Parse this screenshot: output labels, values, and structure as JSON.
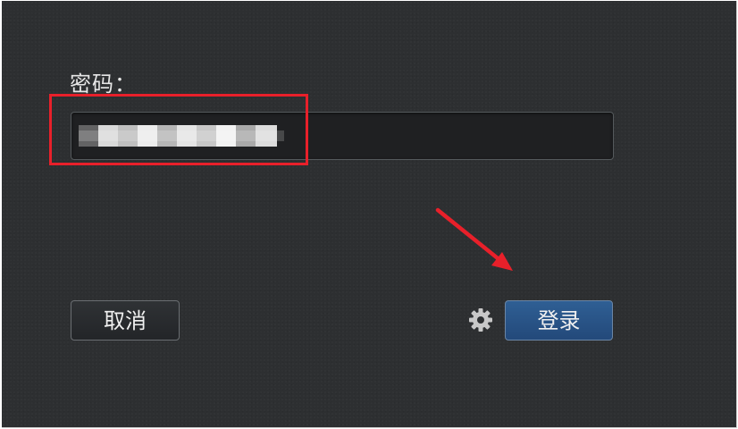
{
  "login": {
    "password_label": "密码：",
    "cancel_label": "取消",
    "login_label": "登录"
  },
  "icons": {
    "settings": "gear-icon",
    "annotation": "red-arrow"
  },
  "colors": {
    "background": "#2d2f31",
    "login_button": "#2a5487",
    "highlight": "#e8202a"
  }
}
